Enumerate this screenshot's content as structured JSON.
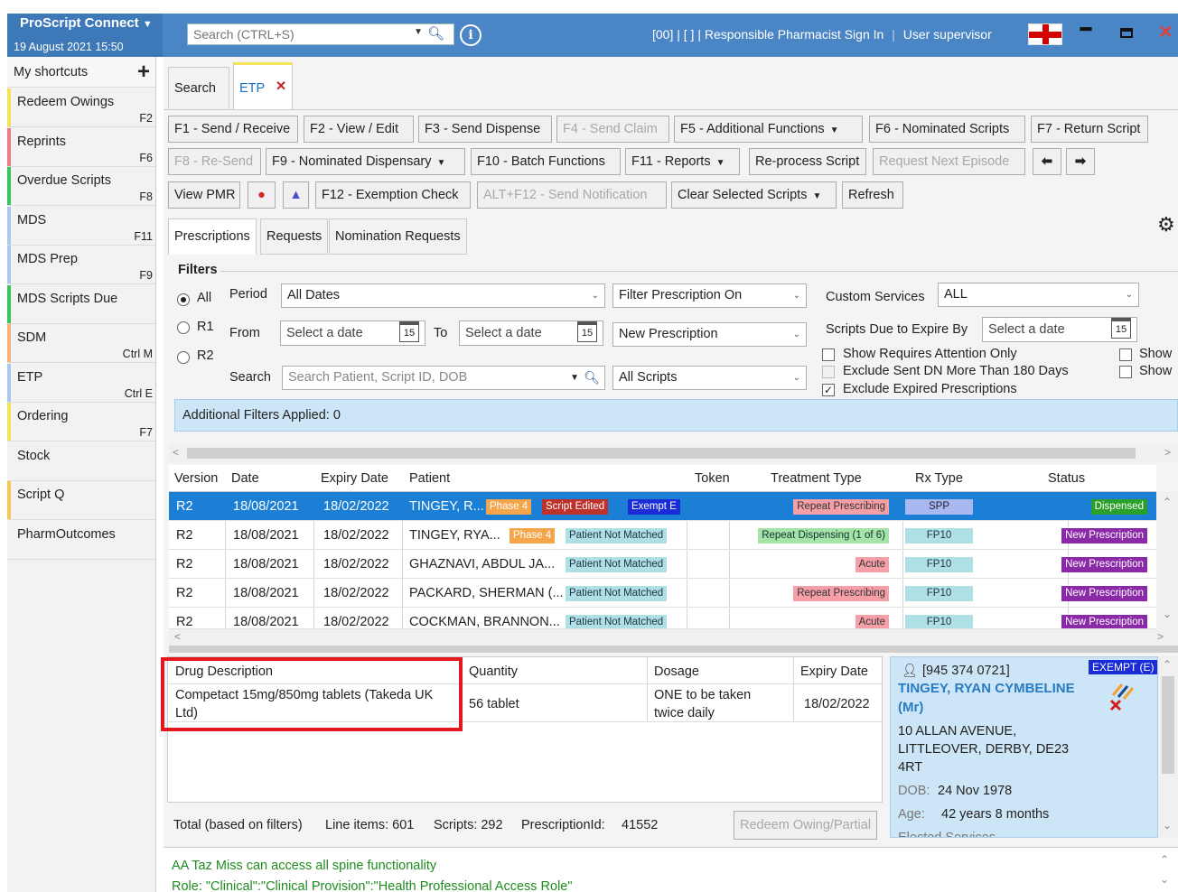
{
  "app": {
    "brand": "ProScript Connect",
    "brand_caret": "▼",
    "datetime": "19 August 2021 15:50"
  },
  "topbar": {
    "search_placeholder": "Search (CTRL+S)",
    "icons_label": "[00] | [ ] |",
    "rp_sign_in": "Responsible Pharmacist Sign In",
    "separator": "|",
    "user": "User supervisor"
  },
  "sidebar": {
    "header": "My shortcuts",
    "items": [
      {
        "label": "Redeem Owings",
        "key": "F2",
        "color": "#f2e35a"
      },
      {
        "label": "Reprints",
        "key": "F6",
        "color": "#f07a8a"
      },
      {
        "label": "Overdue Scripts",
        "key": "F8",
        "color": "#3cc45a"
      },
      {
        "label": "MDS",
        "key": "F11",
        "color": "#a9c9ec"
      },
      {
        "label": "MDS Prep",
        "key": "F9",
        "color": "#a9c9ec"
      },
      {
        "label": "MDS Scripts Due",
        "key": "",
        "color": "#3cc45a"
      },
      {
        "label": "SDM",
        "key": "Ctrl M",
        "color": "#f5b37a"
      },
      {
        "label": "ETP",
        "key": "Ctrl E",
        "color": "#a9c9ec"
      },
      {
        "label": "Ordering",
        "key": "F7",
        "color": "#f2e35a"
      },
      {
        "label": "Stock",
        "key": "",
        "color": "#f2f2f2"
      },
      {
        "label": "Script Q",
        "key": "",
        "color": "#f5c65a"
      },
      {
        "label": "PharmOutcomes",
        "key": "",
        "color": "#f2f2f2"
      }
    ]
  },
  "tabs": {
    "search": "Search",
    "etp": "ETP",
    "close": "✕"
  },
  "toolbar": {
    "row1": [
      "F1 - Send / Receive",
      "F2 - View / Edit",
      "F3 - Send Dispense",
      "F4 - Send Claim",
      "F5 - Additional Functions",
      "F6 - Nominated Scripts",
      "F7 - Return Script"
    ],
    "row2": [
      "F8 - Re-Send",
      "F9 - Nominated Dispensary",
      "F10 - Batch Functions",
      "F11 - Reports",
      "Re-process Script",
      "Request Next Episode"
    ],
    "row3": [
      "View PMR",
      "F12 - Exemption Check",
      "ALT+F12 - Send Notification",
      "Clear Selected Scripts",
      "Refresh"
    ]
  },
  "subtabs": [
    "Prescriptions",
    "Requests",
    "Nomination Requests"
  ],
  "filters": {
    "title": "Filters",
    "radios": [
      "All",
      "R1",
      "R2"
    ],
    "period_label": "Period",
    "period_value": "All Dates",
    "filter_on": "Filter Prescription On",
    "from_label": "From",
    "to_label": "To",
    "date_placeholder": "Select a date",
    "cal_day": "15",
    "new_prescription": "New Prescription",
    "search_label": "Search",
    "search_placeholder": "Search Patient, Script ID, DOB",
    "all_scripts": "All Scripts",
    "custom_services_label": "Custom Services",
    "custom_services_value": "ALL",
    "scripts_due_label": "Scripts Due to Expire By",
    "checks": [
      {
        "label": "Show Requires Attention Only",
        "checked": false
      },
      {
        "label": "Exclude Sent DN More Than 180 Days",
        "checked": false
      },
      {
        "label": "Exclude Expired Prescriptions",
        "checked": true
      }
    ],
    "show_checks": [
      "Show",
      "Show"
    ],
    "additional": "Additional Filters Applied: 0"
  },
  "grid": {
    "columns": [
      "Version",
      "Date",
      "Expiry Date",
      "Patient",
      "Token",
      "Treatment Type",
      "Rx Type",
      "Status"
    ],
    "rows": [
      {
        "version": "R2",
        "date": "18/08/2021",
        "expiry": "18/02/2022",
        "patient": "TINGEY, R...",
        "tags": [
          "Phase 4",
          "Script Edited",
          "Exempt E"
        ],
        "treatment": "Repeat Prescribing",
        "rx": "SPP",
        "status": "Dispensed"
      },
      {
        "version": "R2",
        "date": "18/08/2021",
        "expiry": "18/02/2022",
        "patient": "TINGEY, RYA...",
        "tags": [
          "Phase 4",
          "Patient Not Matched"
        ],
        "treatment": "Repeat Dispensing  (1 of 6)",
        "rx": "FP10",
        "status": "New Prescription"
      },
      {
        "version": "R2",
        "date": "18/08/2021",
        "expiry": "18/02/2022",
        "patient": "GHAZNAVI, ABDUL JA...",
        "tags": [
          "Patient Not Matched"
        ],
        "treatment": "Acute",
        "rx": "FP10",
        "status": "New Prescription"
      },
      {
        "version": "R2",
        "date": "18/08/2021",
        "expiry": "18/02/2022",
        "patient": "PACKARD, SHERMAN (...",
        "tags": [
          "Patient Not Matched"
        ],
        "treatment": "Repeat Prescribing",
        "rx": "FP10",
        "status": "New Prescription"
      },
      {
        "version": "R2",
        "date": "18/08/2021",
        "expiry": "18/02/2022",
        "patient": "COCKMAN, BRANNON...",
        "tags": [
          "Patient Not Matched"
        ],
        "treatment": "Acute",
        "rx": "FP10",
        "status": "New Prescription"
      }
    ]
  },
  "drug": {
    "columns": [
      "Drug Description",
      "Quantity",
      "Dosage",
      "Expiry Date"
    ],
    "description_line1": "Competact 15mg/850mg tablets (Takeda UK",
    "description_line2": "Ltd)",
    "quantity": "56 tablet",
    "dosage_line1": "ONE to be taken",
    "dosage_line2": "twice daily",
    "expiry": "18/02/2022"
  },
  "totals": {
    "label": "Total (based on filters)",
    "line_items": "Line items: 601",
    "scripts": "Scripts: 292",
    "prescription_id_label": "PrescriptionId:",
    "prescription_id": "41552",
    "redeem_button": "Redeem Owing/Partial"
  },
  "patient": {
    "nhs": "[945 374 0721]",
    "name_line1": "TINGEY, RYAN CYMBELINE",
    "name_line2": "(Mr)",
    "exempt": "EXEMPT (E)",
    "addr1": "10 ALLAN AVENUE,",
    "addr2": "LITTLEOVER, DERBY, DE23",
    "addr3": "4RT",
    "dob_label": "DOB:",
    "dob": "24 Nov 1978",
    "age_label": "Age:",
    "age": "42 years 8 months",
    "services": "Elected Services"
  },
  "messages": {
    "line1": "AA Taz Miss can access all spine functionality",
    "line2": "Role: \"Clinical\":\"Clinical Provision\":\"Health Professional Access Role\""
  }
}
